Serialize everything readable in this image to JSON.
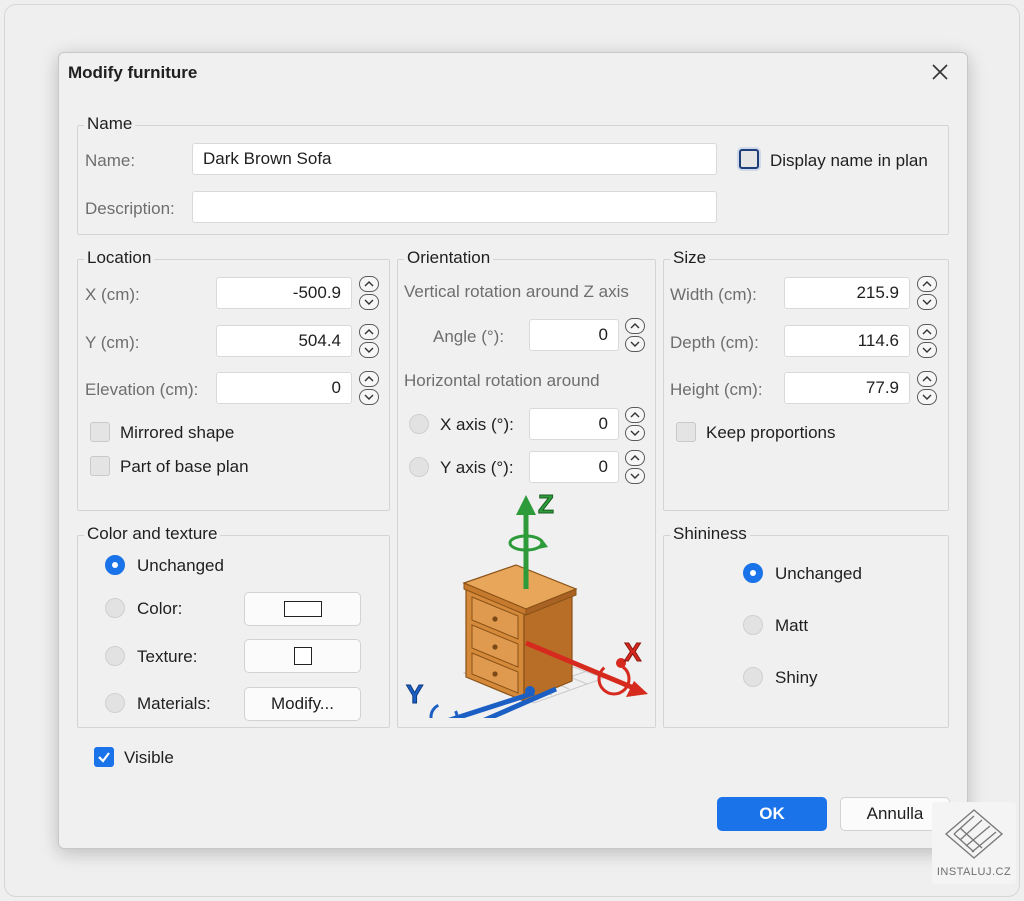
{
  "dialog": {
    "title": "Modify furniture"
  },
  "name_group": {
    "label": "Name",
    "name_label": "Name:",
    "name_value": "Dark Brown Sofa",
    "description_label": "Description:",
    "description_value": "",
    "display_name_label": "Display name in plan",
    "display_name_checked": false
  },
  "location": {
    "label": "Location",
    "x_label": "X (cm):",
    "x_value": "-500.9",
    "y_label": "Y (cm):",
    "y_value": "504.4",
    "elevation_label": "Elevation (cm):",
    "elevation_value": "0",
    "mirrored_label": "Mirrored shape",
    "mirrored_checked": false,
    "base_plan_label": "Part of base plan",
    "base_plan_checked": false
  },
  "orientation": {
    "label": "Orientation",
    "vertical_label": "Vertical rotation around Z axis",
    "angle_label": "Angle (°):",
    "angle_value": "0",
    "horizontal_label": "Horizontal rotation around",
    "x_axis_label": "X axis (°):",
    "x_axis_value": "0",
    "y_axis_label": "Y axis (°):",
    "y_axis_value": "0",
    "axis_letters": {
      "z": "Z",
      "x": "X",
      "y": "Y"
    },
    "icon": "rotation-axes-furniture-icon"
  },
  "size": {
    "label": "Size",
    "width_label": "Width (cm):",
    "width_value": "215.9",
    "depth_label": "Depth (cm):",
    "depth_value": "114.6",
    "height_label": "Height (cm):",
    "height_value": "77.9",
    "keep_label": "Keep proportions",
    "keep_checked": false
  },
  "color_texture": {
    "label": "Color and texture",
    "unchanged_label": "Unchanged",
    "color_label": "Color:",
    "texture_label": "Texture:",
    "materials_label": "Materials:",
    "modify_label": "Modify...",
    "selected": "Unchanged"
  },
  "shininess": {
    "label": "Shininess",
    "unchanged_label": "Unchanged",
    "matt_label": "Matt",
    "shiny_label": "Shiny",
    "selected": "Unchanged"
  },
  "visible": {
    "label": "Visible",
    "checked": true
  },
  "buttons": {
    "ok_label": "OK",
    "cancel_label": "Annulla"
  },
  "watermark": {
    "text": "INSTALUJ.CZ"
  },
  "colors": {
    "accent": "#1a73e8",
    "background": "#f0f0f0",
    "axis_x": "#d62a1e",
    "axis_y": "#1c5fc4",
    "axis_z": "#2e9b3a"
  }
}
